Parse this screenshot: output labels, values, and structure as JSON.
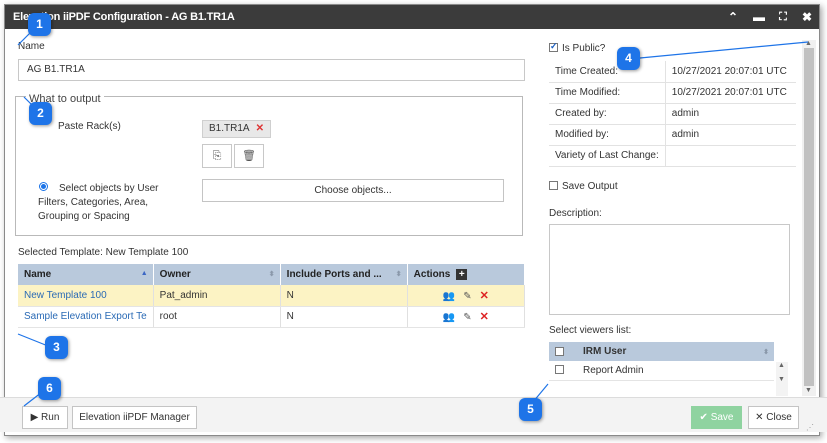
{
  "window": {
    "title": "Elevation iiPDF Configuration - AG B1.TR1A",
    "controls": [
      "chevron-up",
      "minimize",
      "expand",
      "close"
    ]
  },
  "name_field": {
    "label": "Name",
    "value": "AG B1.TR1A"
  },
  "output": {
    "legend": "What to output",
    "paste_rack_label": "Paste Rack(s)",
    "rack_chip": "B1.TR1A",
    "chip_remove": "✕",
    "select_objects_label": "Select objects by User Filters, Categories, Area, Grouping or Spacing",
    "choose_objects_button": "Choose objects..."
  },
  "selected_template": "Selected Template: New Template 100",
  "templates_table": {
    "columns": [
      "Name",
      "Owner",
      "Include Ports and ...",
      "Actions"
    ],
    "add_icon": "+",
    "rows": [
      {
        "name": "New Template 100",
        "owner": "Pat_admin",
        "include": "N",
        "selected": true
      },
      {
        "name": "Sample Elevation Export Te",
        "owner": "root",
        "include": "N",
        "selected": false
      }
    ]
  },
  "right_panel": {
    "is_public_label": "Is Public?",
    "is_public": true,
    "info": [
      {
        "key": "Time Created:",
        "value": "10/27/2021 20:07:01   UTC"
      },
      {
        "key": "Time Modified:",
        "value": "10/27/2021 20:07:01   UTC"
      },
      {
        "key": "Created by:",
        "value": "admin"
      },
      {
        "key": "Modified by:",
        "value": "admin"
      },
      {
        "key": "Variety of Last Change:",
        "value": ""
      }
    ],
    "save_output_label": "Save Output",
    "description_label": "Description:",
    "viewers_label": "Select viewers list:",
    "viewers_header": "IRM User",
    "viewers": [
      "Report Admin"
    ]
  },
  "footer": {
    "run_label": "Run",
    "manager_label": "Elevation iiPDF Manager",
    "save_label": "Save",
    "close_label": "Close"
  },
  "callouts": [
    "1",
    "2",
    "3",
    "4",
    "5",
    "6"
  ],
  "colors": {
    "callout": "#1e74e8",
    "titlebar": "#3b3b3b",
    "header": "#b9c9dc",
    "selected_row": "#fcf3c4",
    "save": "#8fd3a0"
  }
}
